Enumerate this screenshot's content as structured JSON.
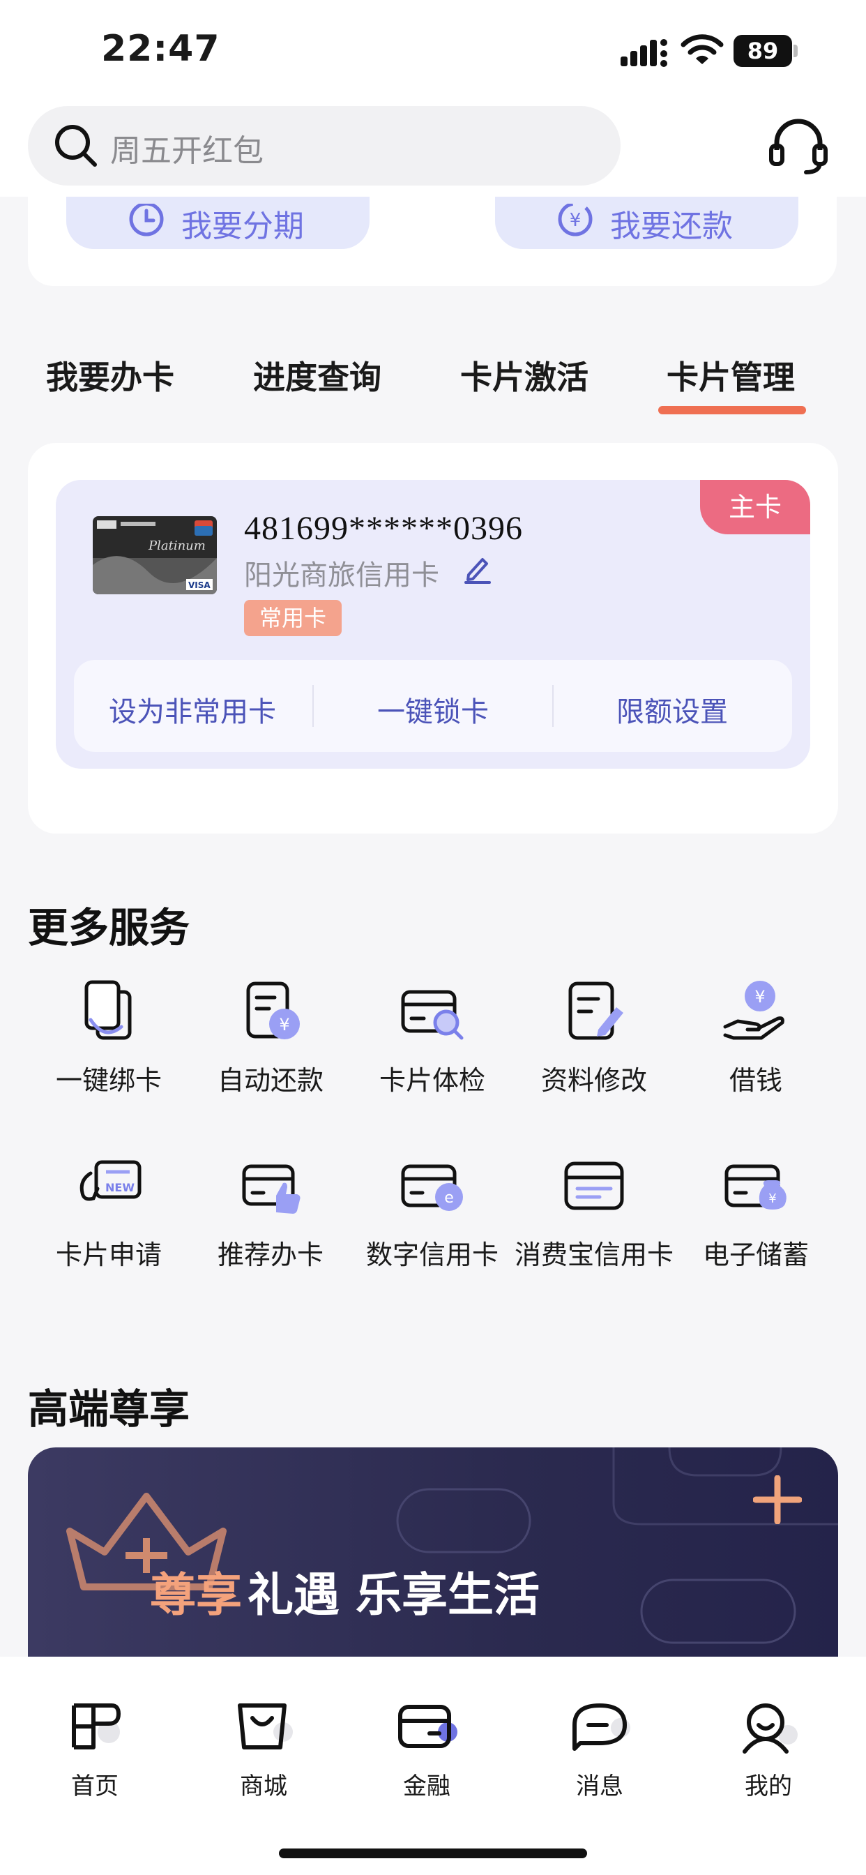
{
  "status_bar": {
    "time": "22:47",
    "battery": "89"
  },
  "header": {
    "search_placeholder": "周五开红包"
  },
  "quick_actions": [
    {
      "label": "我要分期"
    },
    {
      "label": "我要还款"
    }
  ],
  "tabs": [
    {
      "label": "我要办卡"
    },
    {
      "label": "进度查询"
    },
    {
      "label": "卡片激活"
    },
    {
      "label": "卡片管理",
      "active": true
    }
  ],
  "card": {
    "badge": "主卡",
    "number": "481699******0396",
    "name": "阳光商旅信用卡",
    "tag": "常用卡",
    "actions": [
      {
        "label": "设为非常用卡"
      },
      {
        "label": "一键锁卡"
      },
      {
        "label": "限额设置"
      }
    ]
  },
  "more_services": {
    "title": "更多服务",
    "items": [
      {
        "label": "一键绑卡",
        "icon": "bind-card-icon"
      },
      {
        "label": "自动还款",
        "icon": "auto-repay-icon"
      },
      {
        "label": "卡片体检",
        "icon": "card-check-icon"
      },
      {
        "label": "资料修改",
        "icon": "edit-profile-icon"
      },
      {
        "label": "借钱",
        "icon": "borrow-icon"
      },
      {
        "label": "卡片申请",
        "icon": "card-apply-icon"
      },
      {
        "label": "推荐办卡",
        "icon": "recommend-card-icon"
      },
      {
        "label": "数字信用卡",
        "icon": "digital-card-icon"
      },
      {
        "label": "消费宝信用卡",
        "icon": "consume-card-icon"
      },
      {
        "label": "电子储蓄",
        "icon": "e-savings-icon"
      }
    ]
  },
  "premium": {
    "title": "高端尊享",
    "banner_highlight": "尊享",
    "banner_rest": "礼遇 乐享生活"
  },
  "bottom_nav": [
    {
      "label": "首页",
      "icon": "home-icon"
    },
    {
      "label": "商城",
      "icon": "mall-icon"
    },
    {
      "label": "金融",
      "icon": "finance-icon",
      "active": true
    },
    {
      "label": "消息",
      "icon": "message-icon"
    },
    {
      "label": "我的",
      "icon": "profile-icon"
    }
  ],
  "colors": {
    "accent": "#ef6f52",
    "primary": "#6f73e2",
    "badge": "#ec6b82",
    "tag": "#f4a38d"
  }
}
